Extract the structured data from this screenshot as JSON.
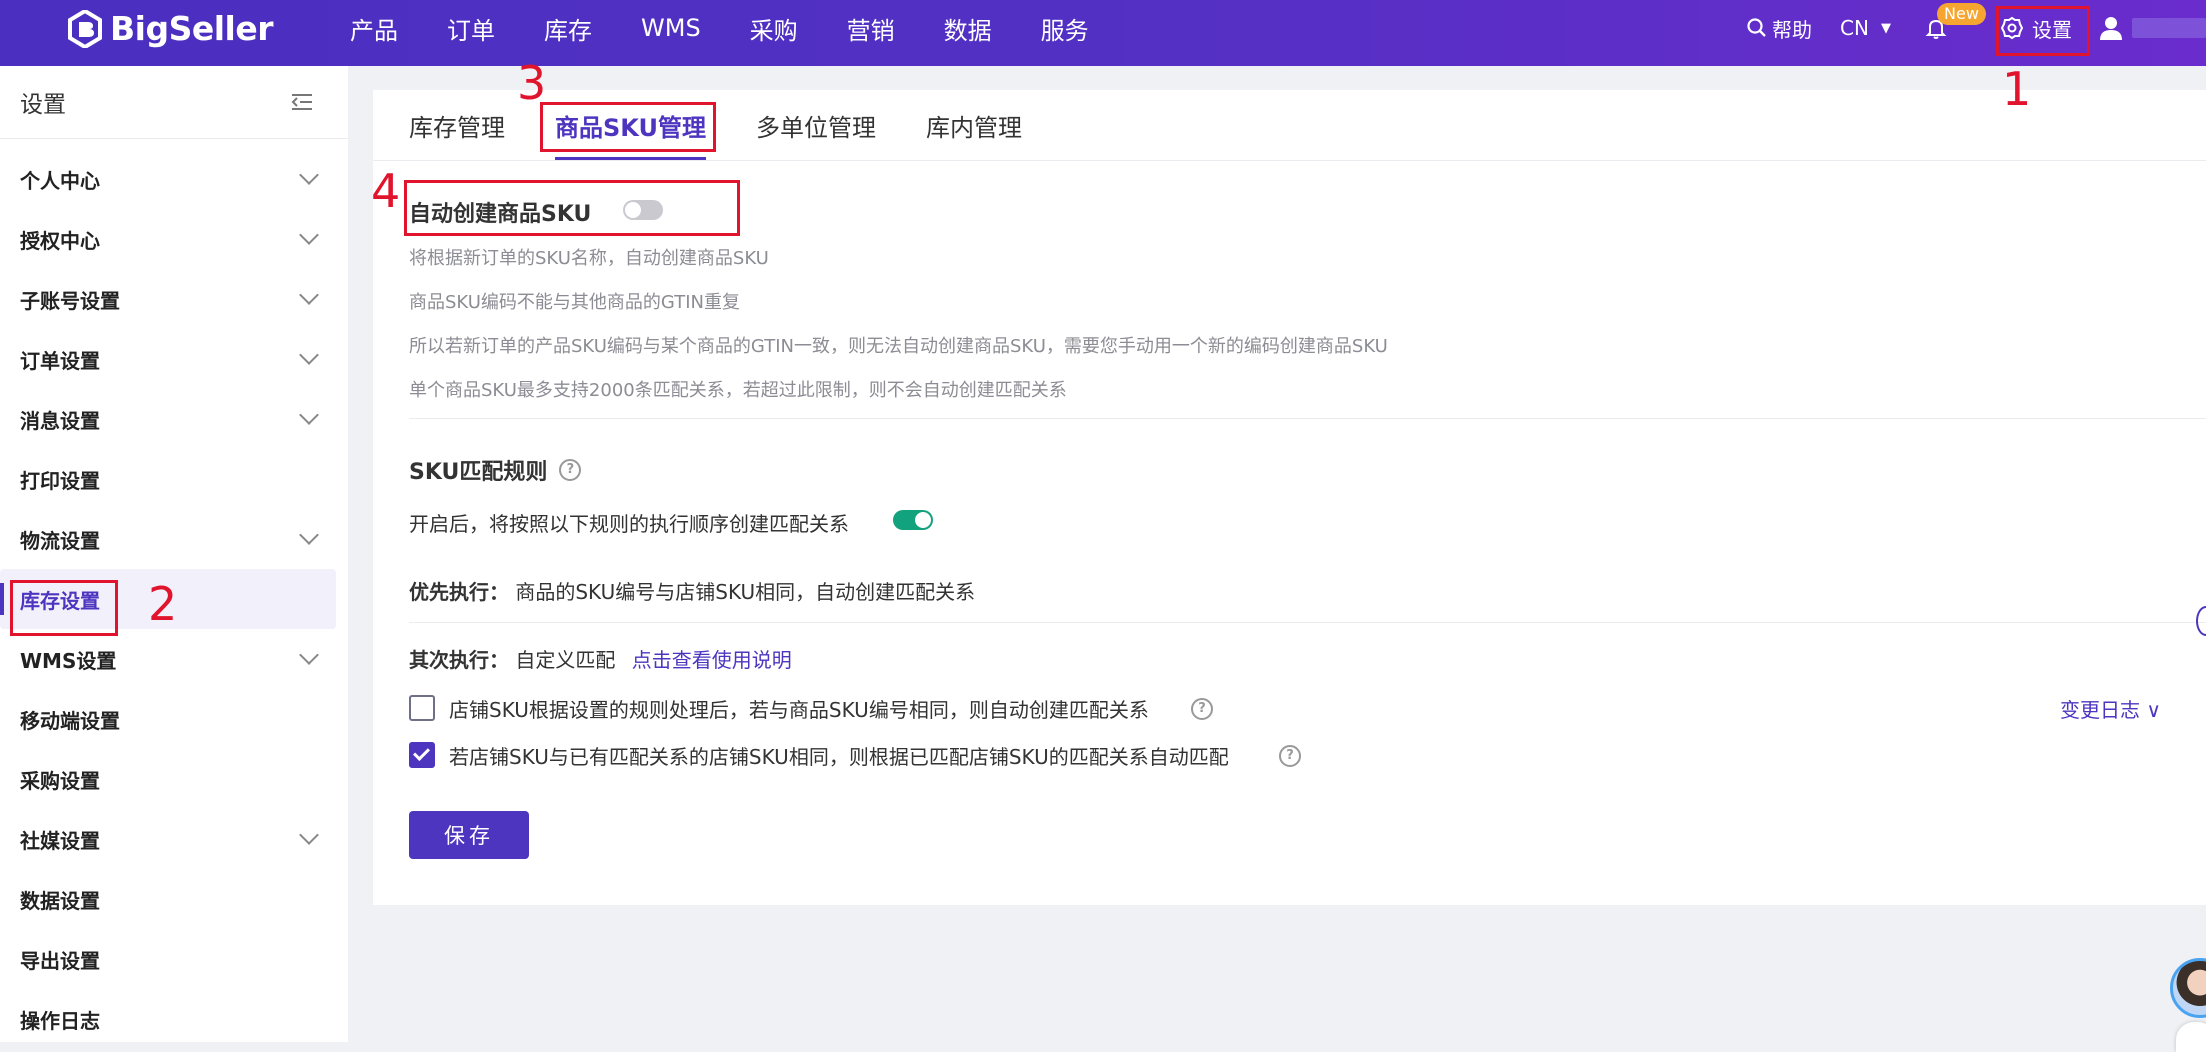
{
  "brand": {
    "name": "BigSeller"
  },
  "nav": [
    "产品",
    "订单",
    "库存",
    "WMS",
    "采购",
    "营销",
    "数据",
    "服务"
  ],
  "topbar": {
    "help": "帮助",
    "lang": "CN",
    "new_badge": "New",
    "settings": "设置"
  },
  "sidebar": {
    "title": "设置",
    "items": [
      {
        "label": "个人中心",
        "expandable": true
      },
      {
        "label": "授权中心",
        "expandable": true
      },
      {
        "label": "子账号设置",
        "expandable": true
      },
      {
        "label": "订单设置",
        "expandable": true
      },
      {
        "label": "消息设置",
        "expandable": true
      },
      {
        "label": "打印设置",
        "expandable": false
      },
      {
        "label": "物流设置",
        "expandable": true
      },
      {
        "label": "库存设置",
        "expandable": false,
        "active": true
      },
      {
        "label": "WMS设置",
        "expandable": true
      },
      {
        "label": "移动端设置",
        "expandable": false
      },
      {
        "label": "采购设置",
        "expandable": false
      },
      {
        "label": "社媒设置",
        "expandable": true
      },
      {
        "label": "数据设置",
        "expandable": false
      },
      {
        "label": "导出设置",
        "expandable": false
      },
      {
        "label": "操作日志",
        "expandable": false
      }
    ]
  },
  "tabs": [
    {
      "label": "库存管理",
      "active": false
    },
    {
      "label": "商品SKU管理",
      "active": true
    },
    {
      "label": "多单位管理",
      "active": false
    },
    {
      "label": "库内管理",
      "active": false
    }
  ],
  "auto_create": {
    "title": "自动创建商品SKU",
    "enabled": false,
    "desc": [
      "将根据新订单的SKU名称，自动创建商品SKU",
      "商品SKU编码不能与其他商品的GTIN重复",
      "所以若新订单的产品SKU编码与某个商品的GTIN一致，则无法自动创建商品SKU，需要您手动用一个新的编码创建商品SKU",
      "单个商品SKU最多支持2000条匹配关系，若超过此限制，则不会自动创建匹配关系"
    ]
  },
  "match_rules": {
    "title": "SKU匹配规则",
    "enable_text": "开启后，将按照以下规则的执行顺序创建匹配关系",
    "enabled": true,
    "priority_label": "优先执行：",
    "priority_text": "商品的SKU编号与店铺SKU相同，自动创建匹配关系",
    "secondary_label": "其次执行：",
    "secondary_text": "自定义匹配",
    "secondary_link": "点击查看使用说明",
    "options": [
      {
        "label": "店铺SKU根据设置的规则处理后，若与商品SKU编号相同，则自动创建匹配关系",
        "checked": false
      },
      {
        "label": "若店铺SKU与已有匹配关系的店铺SKU相同，则根据已匹配店铺SKU的匹配关系自动匹配",
        "checked": true
      }
    ],
    "changelog": "变更日志"
  },
  "save_label": "保存",
  "annotations": [
    "1",
    "2",
    "3",
    "4"
  ],
  "colors": {
    "accent": "#4d35c0",
    "toggle_on": "#13a27e",
    "annotation": "#e0142c",
    "badge": "#f7a531"
  }
}
